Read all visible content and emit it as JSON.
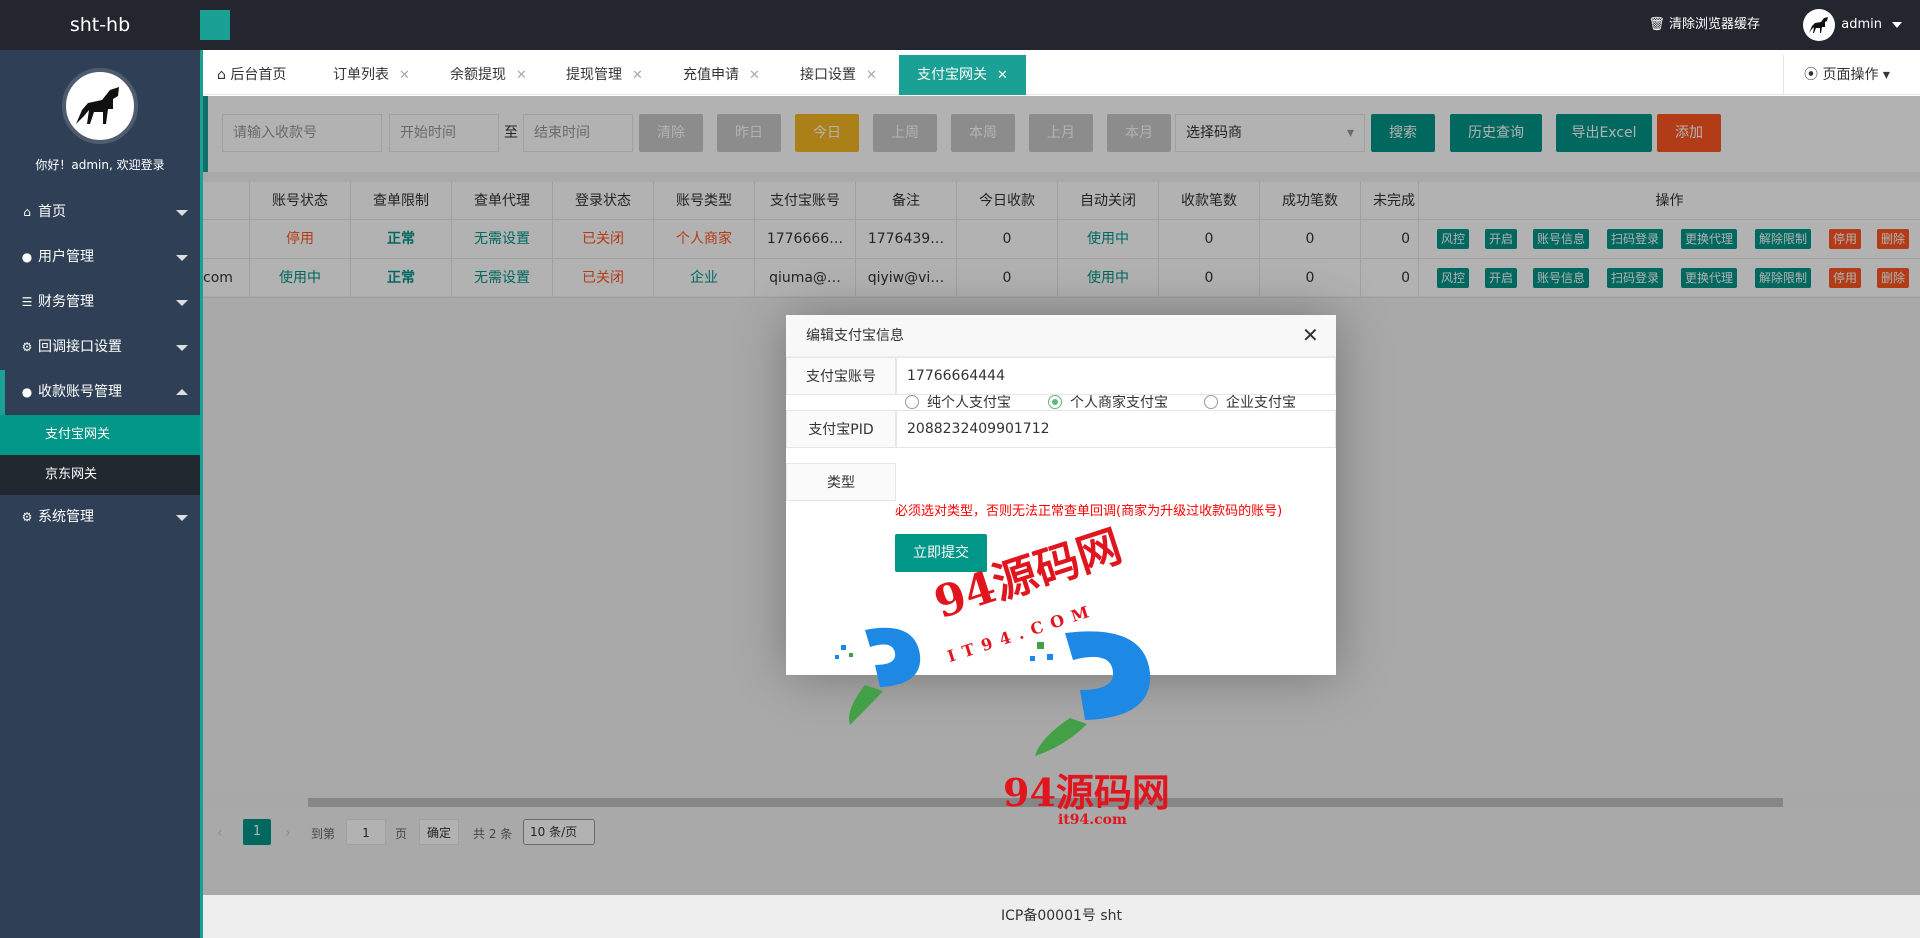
{
  "topbar": {
    "brand": "sht-hb",
    "clear_cache": "清除浏览器缓存",
    "user": "admin"
  },
  "sidebar": {
    "welcome": "你好！admin, 欢迎登录",
    "items": [
      {
        "label": "首页",
        "icon": "home-icon"
      },
      {
        "label": "用户管理",
        "icon": "user-icon"
      },
      {
        "label": "财务管理",
        "icon": "list-icon"
      },
      {
        "label": "回调接口设置",
        "icon": "gear-icon"
      },
      {
        "label": "收款账号管理",
        "icon": "users-icon"
      },
      {
        "label": "系统管理",
        "icon": "gear-icon"
      }
    ],
    "sub_items": [
      "支付宝网关",
      "京东网关"
    ]
  },
  "tabs": {
    "home": "后台首页",
    "items": [
      "订单列表",
      "余额提现",
      "提现管理",
      "充值申请",
      "接口设置",
      "支付宝网关"
    ],
    "page_ops": "页面操作"
  },
  "search": {
    "account_placeholder": "请输入收款号",
    "start_placeholder": "开始时间",
    "to": "至",
    "end_placeholder": "结束时间",
    "buttons": [
      "清除",
      "昨日",
      "今日",
      "上周",
      "本周",
      "上月",
      "本月"
    ],
    "select_label": "选择码商",
    "search": "搜索",
    "history": "历史查询",
    "export": "导出Excel",
    "add": "添加"
  },
  "table": {
    "headers": [
      "账号状态",
      "查单限制",
      "查单代理",
      "登录状态",
      "账号类型",
      "支付宝账号",
      "备注",
      "今日收款",
      "自动关闭",
      "收款笔数",
      "成功笔数",
      "未完成",
      "操作"
    ],
    "rows": [
      {
        "partial": "",
        "cells": [
          "停用",
          "正常",
          "无需设置",
          "已关闭",
          "个人商家",
          "1776666…",
          "1776439…",
          "0",
          "使用中",
          "0",
          "0",
          "0"
        ]
      },
      {
        "partial": "com",
        "cells": [
          "使用中",
          "正常",
          "无需设置",
          "已关闭",
          "企业",
          "qiuma@…",
          "qiyiw@vi…",
          "0",
          "使用中",
          "0",
          "0",
          "0"
        ]
      }
    ],
    "actions": [
      "风控",
      "开启",
      "账号信息",
      "扫码登录",
      "更换代理",
      "解除限制",
      "停用",
      "删除"
    ]
  },
  "pager": {
    "current": "1",
    "goto": "到第",
    "page_input": "1",
    "page_unit": "页",
    "confirm": "确定",
    "total": "共 2 条",
    "per_page": "10 条/页"
  },
  "footer": "ICP备00001号 sht",
  "modal": {
    "title": "编辑支付宝信息",
    "account_label": "支付宝账号",
    "account_value": "17766664444",
    "pid_label": "支付宝PID",
    "pid_value": "2088232409901712",
    "type_label": "类型",
    "types": [
      "纯个人支付宝",
      "个人商家支付宝",
      "企业支付宝"
    ],
    "selected_type": "个人商家支付宝",
    "warning": "必须选对类型，否则无法正常查单回调(商家为升级过收款码的账号)",
    "submit": "立即提交"
  },
  "watermark": {
    "text1": "94源码网",
    "text2": "IT94.COM",
    "text3": "94源码网",
    "text4": "it94.com"
  },
  "colors": {
    "accent": "#1aa094",
    "sidebar": "#2f4056",
    "topbar": "#23262e",
    "danger": "#ff5722",
    "teal": "#009688"
  }
}
